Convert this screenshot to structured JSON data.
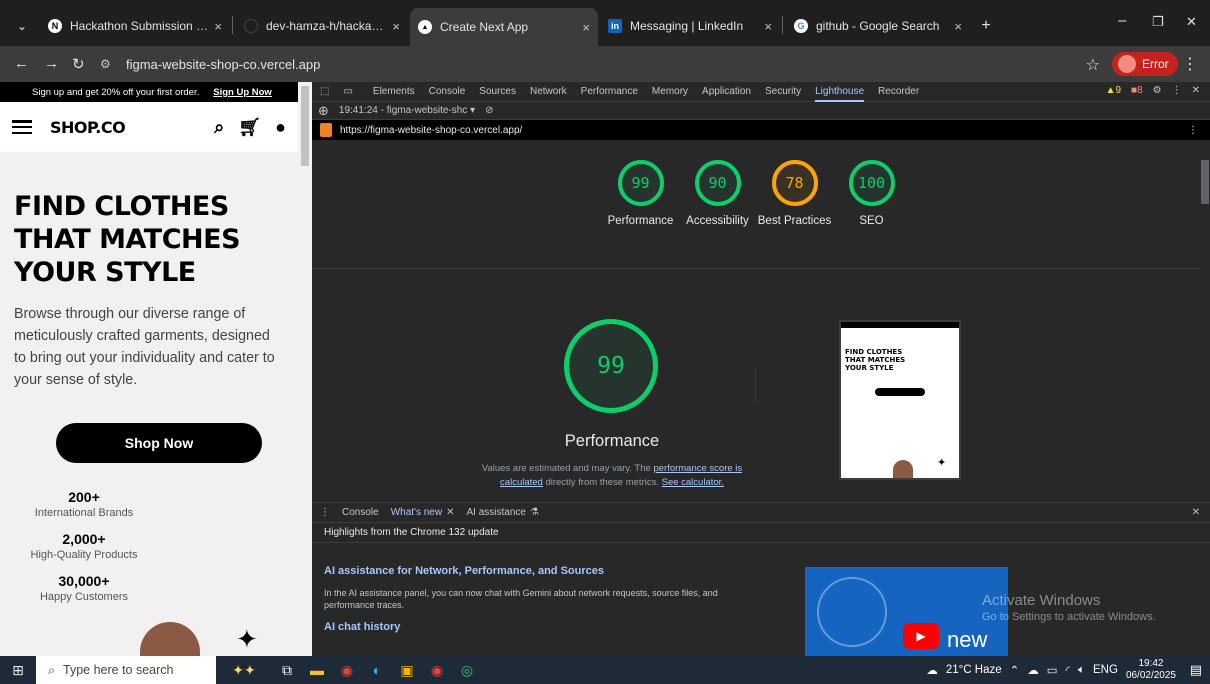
{
  "tabs": [
    {
      "title": "Hackathon Submission Guide",
      "icon": "notion-icon",
      "close": "×"
    },
    {
      "title": "dev-hamza-h/hackathon-docur",
      "icon": "github-icon",
      "close": "×"
    },
    {
      "title": "Create Next App",
      "icon": "vercel-icon",
      "close": "×",
      "active": true
    },
    {
      "title": "Messaging | LinkedIn",
      "icon": "linkedin-icon",
      "close": "×"
    },
    {
      "title": "github - Google Search",
      "icon": "google-icon",
      "close": "×"
    }
  ],
  "new_tab": "+",
  "window_controls": {
    "minimize": "–",
    "restore": "❐",
    "close": "✕"
  },
  "address": {
    "url": "figma-website-shop-co.vercel.app"
  },
  "profile": {
    "label": "Error"
  },
  "site": {
    "promo": "Sign up and get 20% off your first order.",
    "signup": "Sign Up Now",
    "logo": "SHOP.CO",
    "headline": [
      "FIND CLOTHES",
      "THAT MATCHES",
      "YOUR STYLE"
    ],
    "description": "Browse through our diverse range of meticulously crafted garments, designed to bring out your individuality and cater to your sense of style.",
    "cta": "Shop Now",
    "stats": [
      {
        "number": "200+",
        "label": "International Brands"
      },
      {
        "number": "2,000+",
        "label": "High-Quality Products"
      },
      {
        "number": "30,000+",
        "label": "Happy Customers"
      }
    ]
  },
  "devtools": {
    "tabs": [
      "Elements",
      "Console",
      "Sources",
      "Network",
      "Performance",
      "Memory",
      "Application",
      "Security",
      "Lighthouse",
      "Recorder"
    ],
    "active_tab": "Lighthouse",
    "warnings": "9",
    "errors": "8",
    "report_label": "19:41:24 - figma-website-shc ▾",
    "report_url": "https://figma-website-shop-co.vercel.app/",
    "scores": [
      {
        "label": "Performance",
        "value": 99,
        "status": "good"
      },
      {
        "label": "Accessibility",
        "value": 90,
        "status": "good"
      },
      {
        "label": "Best Practices",
        "value": 78,
        "status": "average"
      },
      {
        "label": "SEO",
        "value": 100,
        "status": "good"
      }
    ],
    "big_score": {
      "value": 99,
      "label": "Performance"
    },
    "note_pre": "Values are estimated and may vary. The ",
    "note_link1": "performance score is calculated",
    "note_mid": " directly from these metrics. ",
    "note_link2": "See calculator."
  },
  "drawer": {
    "tabs": [
      "Console",
      "What's new",
      "AI assistance"
    ],
    "active_tab": "What's new",
    "highlights": "Highlights from the Chrome 132 update",
    "heading": "AI assistance for Network, Performance, and Sources",
    "body": "In the AI assistance panel, you can now chat with Gemini about network requests, source files, and performance traces.",
    "subheading": "AI chat history",
    "video_text": "new"
  },
  "watermark": {
    "title": "Activate Windows",
    "subtitle": "Go to Settings to activate Windows."
  },
  "taskbar": {
    "search_placeholder": "Type here to search",
    "weather": "21°C  Haze",
    "lang": "ENG",
    "time": "19:42",
    "date": "06/02/2025"
  },
  "colors": {
    "good": "#0cce6b",
    "average": "#ffa400",
    "accent": "#a8c7fa"
  }
}
